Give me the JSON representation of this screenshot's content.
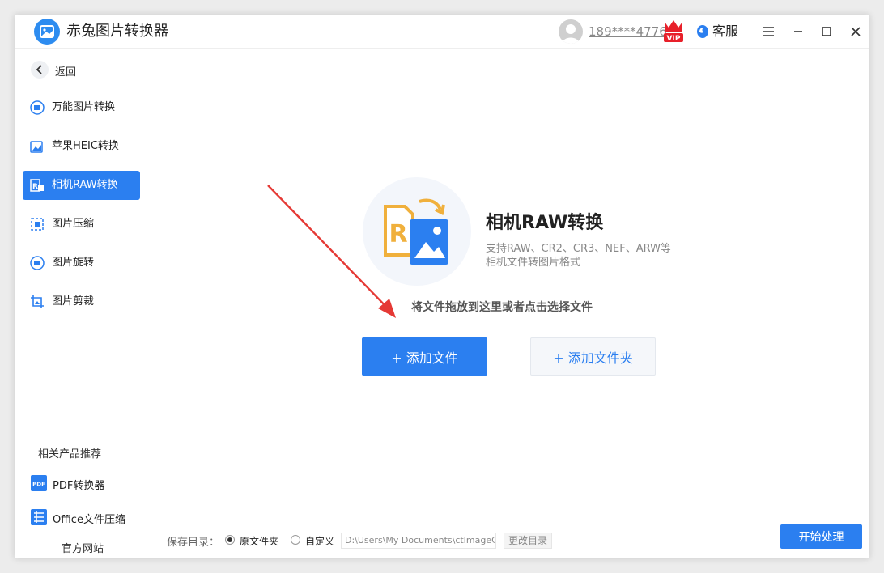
{
  "app": {
    "title": "赤兔图片转换器",
    "user_phone": "189****4776",
    "vip_text": "VIP",
    "service_label": "客服"
  },
  "sidebar": {
    "back_label": "返回",
    "items": [
      {
        "label": "万能图片转换",
        "icon": "image-convert-icon",
        "active": false
      },
      {
        "label": "苹果HEIC转换",
        "icon": "heic-icon",
        "active": false
      },
      {
        "label": "相机RAW转换",
        "icon": "raw-icon",
        "active": true
      },
      {
        "label": "图片压缩",
        "icon": "compress-icon",
        "active": false
      },
      {
        "label": "图片旋转",
        "icon": "rotate-icon",
        "active": false
      },
      {
        "label": "图片剪裁",
        "icon": "crop-icon",
        "active": false
      }
    ],
    "recommend_title": "相关产品推荐",
    "recommend": [
      {
        "label": "PDF转换器",
        "icon": "pdf-icon",
        "badge": "PDF"
      },
      {
        "label": "Office文件压缩",
        "icon": "office-compress-icon"
      }
    ],
    "official_site": "官方网站"
  },
  "main": {
    "title": "相机RAW转换",
    "description": "支持RAW、CR2、CR3、NEF、ARW等相机文件转图片格式",
    "drop_hint": "将文件拖放到这里或者点击选择文件",
    "add_file_label": "+ 添加文件",
    "add_folder_label": "+ 添加文件夹",
    "hero_letter": "R"
  },
  "footer": {
    "save_dir_label": "保存目录：",
    "option_original": "原文件夹",
    "option_custom": "自定义",
    "selected_option": "原文件夹",
    "path_value": "D:\\Users\\My Documents\\ctImageC",
    "change_dir_label": "更改目录",
    "start_label": "开始处理"
  },
  "colors": {
    "accent": "#2b7ff0",
    "vip_red": "#e8202a",
    "raw_orange": "#f0b03c",
    "arrow_red": "#e53935"
  }
}
